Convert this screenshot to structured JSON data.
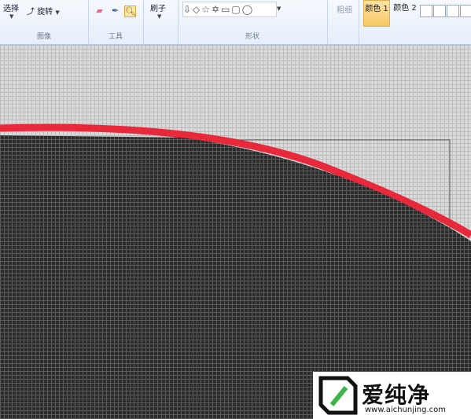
{
  "ribbon": {
    "image_group": {
      "label": "图像",
      "select_label": "选择",
      "rotate_label": "旋转"
    },
    "tools_group": {
      "label": "工具"
    },
    "brush_group": {
      "label": "刷子"
    },
    "shapes_group": {
      "label": "形状",
      "shape_glyphs": "⇩◇☆✡▭▢◯"
    },
    "size_group": {
      "label": "粗细"
    },
    "colors_group": {
      "color1_label": "颜色 1",
      "color2_label": "颜色 2"
    }
  },
  "canvas": {
    "background": "#d9d9d9",
    "fill_color": "#2b2b2b",
    "outline_color": "#e8293b"
  },
  "watermark": {
    "brand": "爱纯净",
    "url": "www.aichunjing.com"
  }
}
